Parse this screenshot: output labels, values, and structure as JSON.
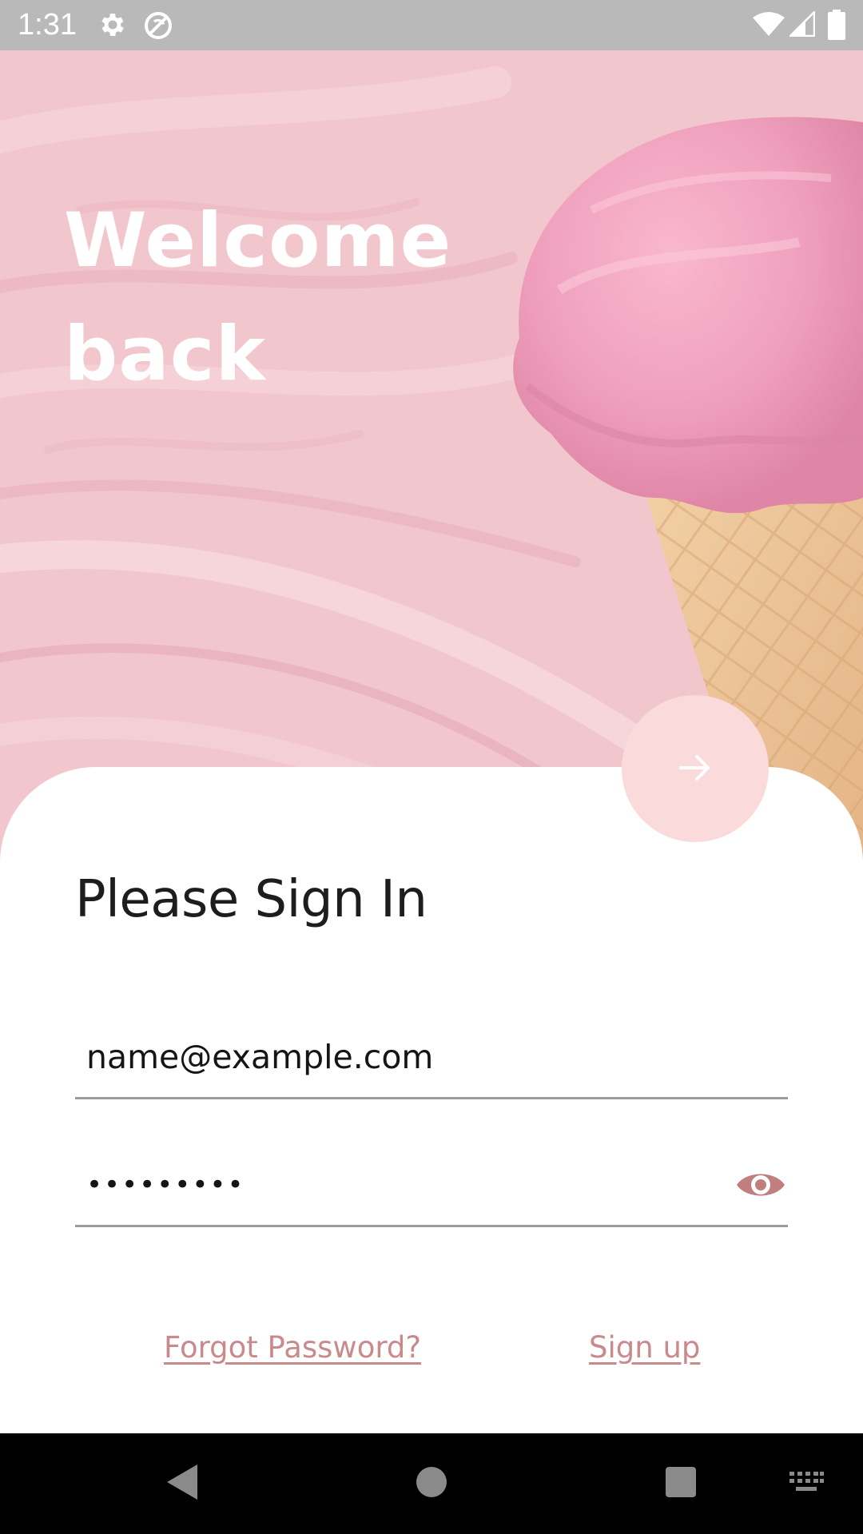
{
  "status_bar": {
    "time": "1:31",
    "left_icons": [
      "gear-icon",
      "do-not-disturb-icon"
    ],
    "right_icons": [
      "wifi-icon",
      "cell-signal-icon",
      "battery-icon"
    ]
  },
  "hero": {
    "title": "Welcome back",
    "image": "pink-ice-cream-cone"
  },
  "login": {
    "heading": "Please Sign In",
    "email_value": "name@example.com",
    "password_value": "•••••••••",
    "submit_icon": "arrow-right-icon",
    "visibility_icon": "eye-icon",
    "forgot_password_label": "Forgot Password?",
    "sign_up_label": "Sign up"
  },
  "colors": {
    "accent": "#C98A8C",
    "fab": "#FBDADC",
    "eye_icon": "#C07E7F",
    "hero_pink": "#F2C6CD"
  },
  "nav_bar": {
    "buttons": [
      "back-icon",
      "home-icon",
      "recents-icon",
      "keyboard-icon"
    ]
  }
}
